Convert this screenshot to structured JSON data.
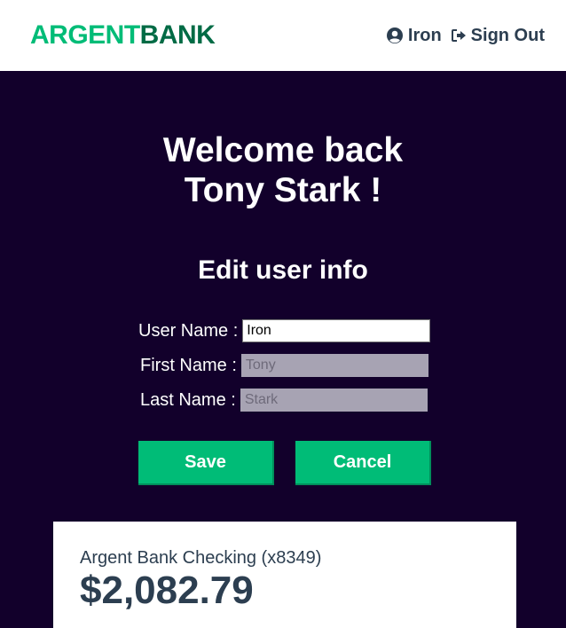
{
  "navbar": {
    "logo_part1": "ARGENT",
    "logo_part2": "BANK",
    "user_label": "Iron",
    "signout_label": "Sign Out",
    "icons": {
      "user": "user-circle-icon",
      "signout": "sign-out-icon"
    }
  },
  "header": {
    "welcome_line1": "Welcome back",
    "welcome_line2": "Tony Stark !",
    "edit_title": "Edit user info"
  },
  "form": {
    "username_label": "User Name :",
    "username_value": "Iron",
    "firstname_label": "First Name :",
    "firstname_value": "Tony",
    "lastname_label": "Last Name :",
    "lastname_value": "Stark",
    "save_label": "Save",
    "cancel_label": "Cancel"
  },
  "account": {
    "title": "Argent Bank Checking (x8349)",
    "amount": "$2,082.79"
  },
  "colors": {
    "brand_green": "#00bc77",
    "brand_dark_green": "#006b45",
    "background": "#12002b",
    "text_dark": "#2c3e50"
  }
}
